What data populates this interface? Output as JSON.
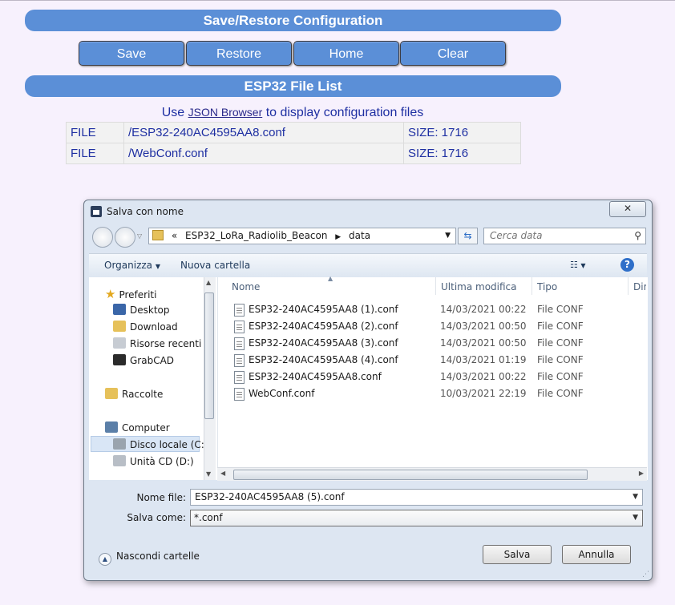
{
  "page": {
    "header_config": "Save/Restore Configuration",
    "buttons": {
      "save": "Save",
      "restore": "Restore",
      "home": "Home",
      "clear": "Clear"
    },
    "header_files": "ESP32 File List",
    "hint": {
      "before": "Use",
      "link": "JSON Browser",
      "after": "to display configuration files"
    },
    "files": [
      {
        "kind": "FILE",
        "path": "/ESP32-240AC4595AA8.conf",
        "size": "SIZE: 1716"
      },
      {
        "kind": "FILE",
        "path": "/WebConf.conf",
        "size": "SIZE: 1716"
      }
    ]
  },
  "dialog": {
    "title": "Salva con nome",
    "close_glyph": "✕",
    "address": {
      "prefix": "«",
      "parts": [
        "ESP32_LoRa_Radiolib_Beacon",
        "data"
      ]
    },
    "search_placeholder": "Cerca data",
    "toolbar": {
      "organize": "Organizza",
      "new_folder": "Nuova cartella",
      "help": "?"
    },
    "nav": {
      "favorites": "Preferiti",
      "fav_items": [
        "Desktop",
        "Download",
        "Risorse recenti",
        "GrabCAD"
      ],
      "libraries": "Raccolte",
      "computer": "Computer",
      "drives": [
        "Disco locale (C:)",
        "Unità CD (D:)"
      ]
    },
    "columns": {
      "name": "Nome",
      "modified": "Ultima modifica",
      "type": "Tipo",
      "dim": "Dim"
    },
    "rows": [
      {
        "name": "ESP32-240AC4595AA8 (1).conf",
        "date": "14/03/2021 00:22",
        "type": "File CONF"
      },
      {
        "name": "ESP32-240AC4595AA8 (2).conf",
        "date": "14/03/2021 00:50",
        "type": "File CONF"
      },
      {
        "name": "ESP32-240AC4595AA8 (3).conf",
        "date": "14/03/2021 00:50",
        "type": "File CONF"
      },
      {
        "name": "ESP32-240AC4595AA8 (4).conf",
        "date": "14/03/2021 01:19",
        "type": "File CONF"
      },
      {
        "name": "ESP32-240AC4595AA8.conf",
        "date": "14/03/2021 00:22",
        "type": "File CONF"
      },
      {
        "name": "WebConf.conf",
        "date": "10/03/2021 22:19",
        "type": "File CONF"
      }
    ],
    "filename_label": "Nome file:",
    "filename_value": "ESP32-240AC4595AA8 (5).conf",
    "saveas_label": "Salva come:",
    "saveas_value": "*.conf",
    "hide_folders": "Nascondi cartelle",
    "save_btn": "Salva",
    "cancel_btn": "Annulla"
  }
}
